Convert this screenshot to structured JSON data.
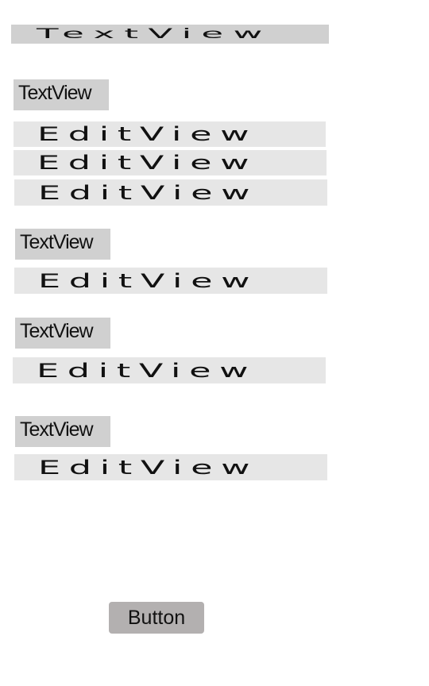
{
  "title_view": {
    "text": "TextView"
  },
  "label_1": {
    "text": "TextView"
  },
  "edit_1": {
    "text": "EditView"
  },
  "edit_2": {
    "text": "EditView"
  },
  "edit_3": {
    "text": "EditView"
  },
  "label_2": {
    "text": "TextView"
  },
  "edit_4": {
    "text": "EditView"
  },
  "label_3": {
    "text": "TextView"
  },
  "edit_5": {
    "text": "EditView"
  },
  "label_4": {
    "text": "TextView"
  },
  "edit_6": {
    "text": "EditView"
  },
  "button": {
    "label": "Button"
  }
}
